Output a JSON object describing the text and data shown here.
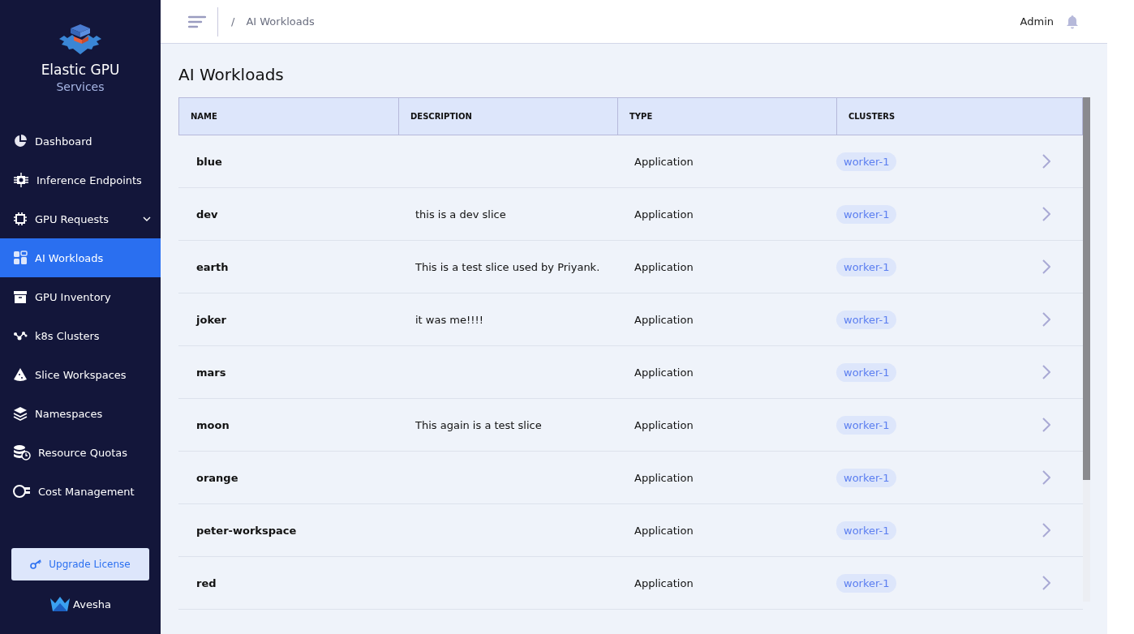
{
  "brand": {
    "title": "Elastic GPU",
    "subtitle": "Services"
  },
  "sidebar": {
    "items": [
      {
        "label": "Dashboard",
        "selected": false,
        "has_submenu": false
      },
      {
        "label": "Inference Endpoints",
        "selected": false,
        "has_submenu": false
      },
      {
        "label": "GPU Requests",
        "selected": false,
        "has_submenu": true
      },
      {
        "label": "AI Workloads",
        "selected": true,
        "has_submenu": false
      },
      {
        "label": "GPU Inventory",
        "selected": false,
        "has_submenu": false
      },
      {
        "label": "k8s Clusters",
        "selected": false,
        "has_submenu": false
      },
      {
        "label": "Slice Workspaces",
        "selected": false,
        "has_submenu": false
      },
      {
        "label": "Namespaces",
        "selected": false,
        "has_submenu": false
      },
      {
        "label": "Resource Quotas",
        "selected": false,
        "has_submenu": false
      },
      {
        "label": "Cost Management",
        "selected": false,
        "has_submenu": false
      }
    ],
    "upgrade_button": "Upgrade License",
    "footer_logo": "Avesha"
  },
  "header": {
    "breadcrumb_separator": "/",
    "breadcrumb": "AI Workloads",
    "user": "Admin"
  },
  "page_title": "AI Workloads",
  "table": {
    "columns": [
      "NAME",
      "DESCRIPTION",
      "TYPE",
      "CLUSTERS"
    ],
    "rows": [
      {
        "name": "blue",
        "type": "Application",
        "clusters": [
          "worker-1"
        ]
      },
      {
        "name": "dev",
        "description": "this is a dev slice",
        "type": "Application",
        "clusters": [
          "worker-1"
        ]
      },
      {
        "name": "earth",
        "description": "This is a test slice used by Priyank.",
        "type": "Application",
        "clusters": [
          "worker-1"
        ]
      },
      {
        "name": "joker",
        "description": "it was me!!!!",
        "type": "Application",
        "clusters": [
          "worker-1"
        ]
      },
      {
        "name": "mars",
        "type": "Application",
        "clusters": [
          "worker-1"
        ]
      },
      {
        "name": "moon",
        "description": "This again is a test slice",
        "type": "Application",
        "clusters": [
          "worker-1"
        ]
      },
      {
        "name": "orange",
        "type": "Application",
        "clusters": [
          "worker-1"
        ]
      },
      {
        "name": "peter-workspace",
        "type": "Application",
        "clusters": [
          "worker-1"
        ]
      },
      {
        "name": "red",
        "type": "Application",
        "clusters": [
          "worker-1"
        ]
      }
    ]
  }
}
